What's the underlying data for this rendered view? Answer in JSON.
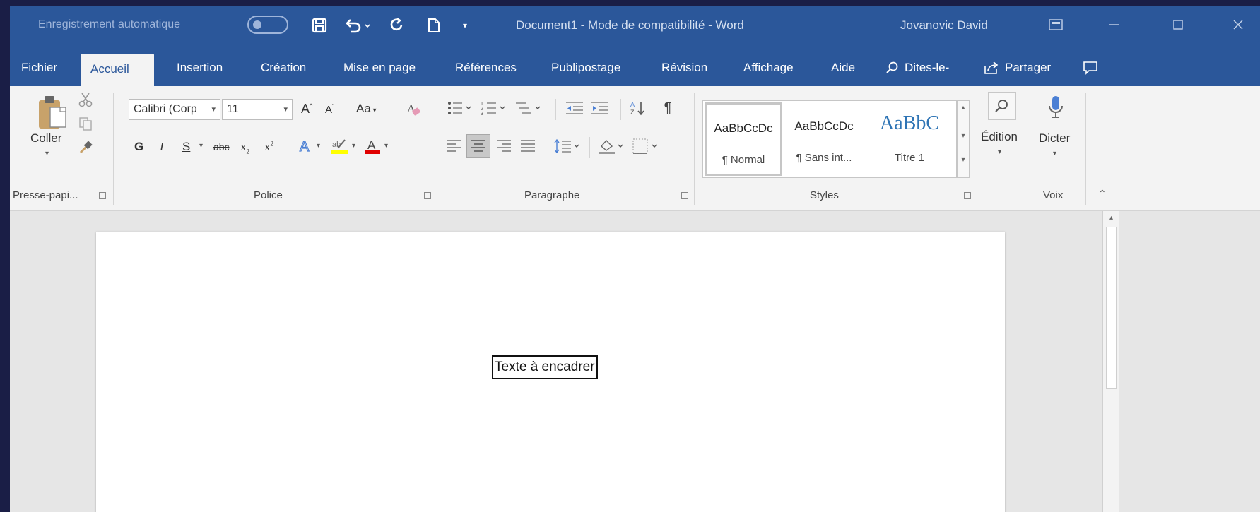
{
  "titlebar": {
    "autosave_label": "Enregistrement automatique",
    "document_title": "Document1  -  Mode de compatibilité  -  Word",
    "user_name": "Jovanovic David"
  },
  "tabs": [
    {
      "label": "Fichier"
    },
    {
      "label": "Accueil",
      "active": true
    },
    {
      "label": "Insertion"
    },
    {
      "label": "Création"
    },
    {
      "label": "Mise en page"
    },
    {
      "label": "Références"
    },
    {
      "label": "Publipostage"
    },
    {
      "label": "Révision"
    },
    {
      "label": "Affichage"
    },
    {
      "label": "Aide"
    }
  ],
  "tell_me": {
    "label": "Dites-le-"
  },
  "share": {
    "label": "Partager"
  },
  "ribbon": {
    "clipboard": {
      "paste_label": "Coller",
      "group_label": "Presse-papi..."
    },
    "font": {
      "font_name": "Calibri (Corp",
      "font_size": "11",
      "group_label": "Police",
      "bold": "G",
      "italic": "I",
      "underline": "S",
      "strike": "abc",
      "change_case": "Aa"
    },
    "paragraph": {
      "group_label": "Paragraphe"
    },
    "styles": {
      "group_label": "Styles",
      "items": [
        {
          "preview": "AaBbCcDc",
          "name": "¶ Normal"
        },
        {
          "preview": "AaBbCcDc",
          "name": "¶ Sans int..."
        },
        {
          "preview": "AaBbC",
          "name": "Titre 1"
        }
      ]
    },
    "editing": {
      "label": "Édition"
    },
    "voice": {
      "dictate_label": "Dicter",
      "group_label": "Voix"
    }
  },
  "document": {
    "framed_text": "Texte à encadrer"
  },
  "colors": {
    "ribbon_blue": "#2b579a",
    "highlight_yellow": "#ffff00",
    "font_color_red": "#e00000"
  }
}
